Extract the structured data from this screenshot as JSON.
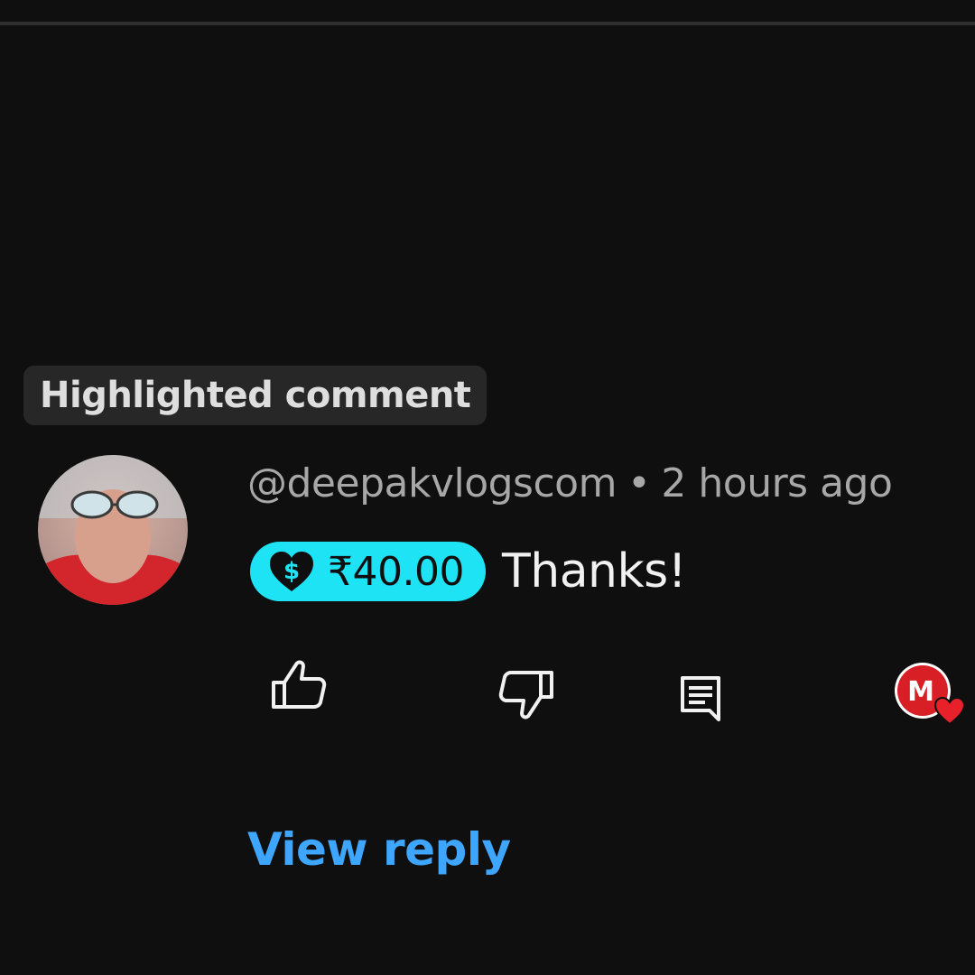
{
  "highlight": {
    "label": "Highlighted comment"
  },
  "comment": {
    "author": "@deepakvlogscom",
    "separator": "•",
    "time": "2 hours ago",
    "thanks": {
      "amount": "₹40.00",
      "icon": "thanks-heart-dollar-icon"
    },
    "text": "Thanks!"
  },
  "actions": {
    "like_icon": "thumbs-up-icon",
    "dislike_icon": "thumbs-down-icon",
    "reply_icon": "comment-reply-icon",
    "creator_heart_icon": "creator-heart-icon"
  },
  "view_reply": "View reply",
  "colors": {
    "background": "#0f0f0f",
    "chip_bg": "#272727",
    "thanks_badge": "#1ee3f5",
    "link": "#3ea6ff",
    "heart": "#e8202a"
  }
}
